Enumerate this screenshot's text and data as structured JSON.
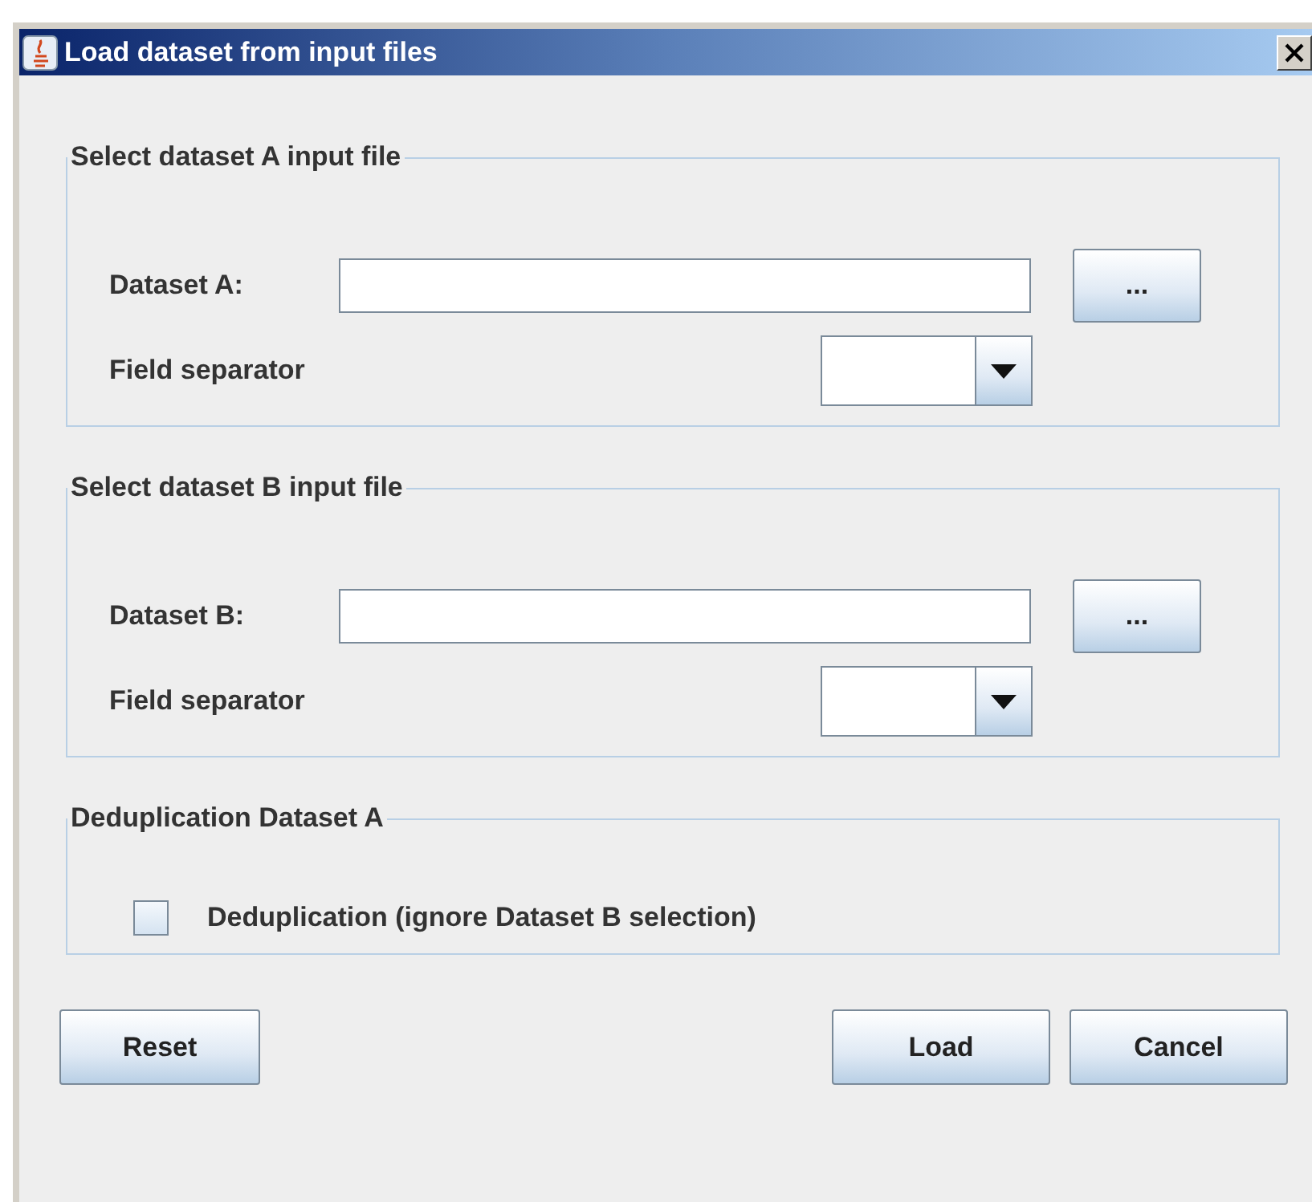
{
  "window": {
    "title": "Load dataset from input files"
  },
  "groups": [
    {
      "kind": "file",
      "title": "Select dataset A input file",
      "file_label": "Dataset A:",
      "browse_label": "...",
      "separator_label": "Field separator"
    },
    {
      "kind": "file",
      "title": "Select dataset B input file",
      "file_label": "Dataset B:",
      "browse_label": "...",
      "separator_label": "Field separator"
    },
    {
      "kind": "checkbox",
      "title": "Deduplication Dataset A",
      "checkbox_label": "Deduplication (ignore Dataset B selection)",
      "checked": false
    }
  ],
  "left_buttons": [
    {
      "label": "Reset"
    }
  ],
  "right_buttons": [
    {
      "label": "Load"
    },
    {
      "label": "Cancel"
    }
  ]
}
